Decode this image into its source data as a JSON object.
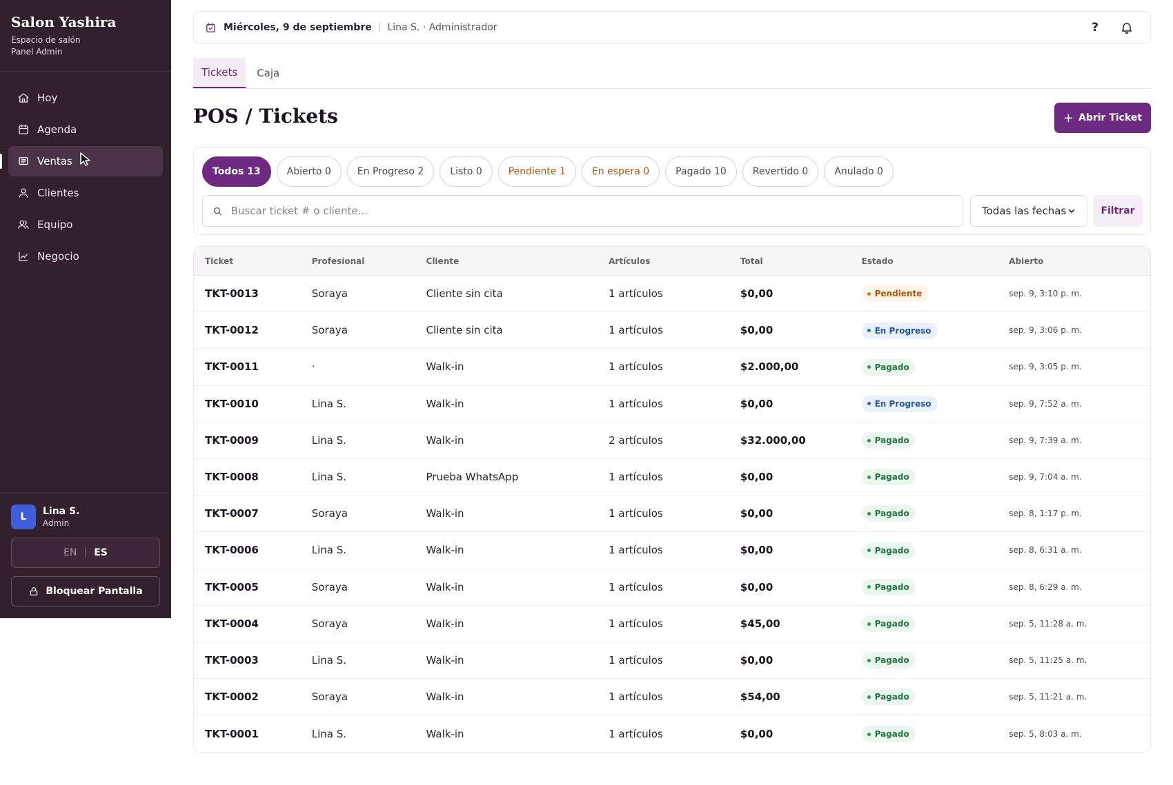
{
  "sidebar": {
    "title": "Salon Yashira",
    "subtitle_1": "Espacio de salón",
    "subtitle_2": "Panel Admin",
    "items": [
      {
        "label": "Hoy",
        "icon": "home-icon"
      },
      {
        "label": "Agenda",
        "icon": "calendar-icon"
      },
      {
        "label": "Ventas",
        "icon": "receipt-icon",
        "active": true
      },
      {
        "label": "Clientes",
        "icon": "user-icon"
      },
      {
        "label": "Equipo",
        "icon": "team-icon"
      },
      {
        "label": "Negocio",
        "icon": "chart-icon"
      }
    ],
    "user": {
      "initial": "L",
      "name": "Lina S.",
      "role": "Admin"
    },
    "lang": {
      "en": "EN",
      "sep": "|",
      "es": "ES",
      "selected": "ES"
    },
    "lock_label": "Bloquear Pantalla"
  },
  "topbar": {
    "date": "Miércoles, 9 de septiembre",
    "sep": "|",
    "user": "Lina S. · Administrador",
    "help": "?"
  },
  "tabs": [
    {
      "label": "Tickets",
      "active": true
    },
    {
      "label": "Caja",
      "active": false
    }
  ],
  "page": {
    "title": "POS / Tickets",
    "open_button": "Abrir Ticket",
    "open_button_icon": "+"
  },
  "filters": {
    "pills": [
      {
        "label": "Todos 13",
        "active": true
      },
      {
        "label": "Abierto 0"
      },
      {
        "label": "En Progreso 2"
      },
      {
        "label": "Listo 0"
      },
      {
        "label": "Pendiente 1",
        "tone": "warn"
      },
      {
        "label": "En espera 0",
        "tone": "warn"
      },
      {
        "label": "Pagado 10"
      },
      {
        "label": "Revertido 0"
      },
      {
        "label": "Anulado 0"
      }
    ],
    "search_placeholder": "Buscar ticket # o cliente...",
    "date_select": "Todas las fechas",
    "filter_button": "Filtrar"
  },
  "table": {
    "headers": [
      "Ticket",
      "Profesional",
      "Cliente",
      "Artículos",
      "Total",
      "Estado",
      "Abierto"
    ],
    "rows": [
      {
        "ticket": "TKT-0013",
        "pro": "Soraya",
        "client": "Cliente sin cita",
        "items": "1 artículos",
        "total": "$0,00",
        "status": "Pendiente",
        "status_key": "pend",
        "opened": "sep. 9, 3:10 p. m."
      },
      {
        "ticket": "TKT-0012",
        "pro": "Soraya",
        "client": "Cliente sin cita",
        "items": "1 artículos",
        "total": "$0,00",
        "status": "En Progreso",
        "status_key": "prog",
        "opened": "sep. 9, 3:06 p. m."
      },
      {
        "ticket": "TKT-0011",
        "pro": "·",
        "client": "Walk-in",
        "items": "1 artículos",
        "total": "$2.000,00",
        "status": "Pagado",
        "status_key": "paid",
        "opened": "sep. 9, 3:05 p. m."
      },
      {
        "ticket": "TKT-0010",
        "pro": "Lina S.",
        "client": "Walk-in",
        "items": "1 artículos",
        "total": "$0,00",
        "status": "En Progreso",
        "status_key": "prog",
        "opened": "sep. 9, 7:52 a. m."
      },
      {
        "ticket": "TKT-0009",
        "pro": "Lina S.",
        "client": "Walk-in",
        "items": "2 artículos",
        "total": "$32.000,00",
        "status": "Pagado",
        "status_key": "paid",
        "opened": "sep. 9, 7:39 a. m."
      },
      {
        "ticket": "TKT-0008",
        "pro": "Lina S.",
        "client": "Prueba WhatsApp",
        "items": "1 artículos",
        "total": "$0,00",
        "status": "Pagado",
        "status_key": "paid",
        "opened": "sep. 9, 7:04 a. m."
      },
      {
        "ticket": "TKT-0007",
        "pro": "Soraya",
        "client": "Walk-in",
        "items": "1 artículos",
        "total": "$0,00",
        "status": "Pagado",
        "status_key": "paid",
        "opened": "sep. 8, 1:17 p. m."
      },
      {
        "ticket": "TKT-0006",
        "pro": "Lina S.",
        "client": "Walk-in",
        "items": "1 artículos",
        "total": "$0,00",
        "status": "Pagado",
        "status_key": "paid",
        "opened": "sep. 8, 6:31 a. m."
      },
      {
        "ticket": "TKT-0005",
        "pro": "Soraya",
        "client": "Walk-in",
        "items": "1 artículos",
        "total": "$0,00",
        "status": "Pagado",
        "status_key": "paid",
        "opened": "sep. 8, 6:29 a. m."
      },
      {
        "ticket": "TKT-0004",
        "pro": "Soraya",
        "client": "Walk-in",
        "items": "1 artículos",
        "total": "$45,00",
        "status": "Pagado",
        "status_key": "paid",
        "opened": "sep. 5, 11:28 a. m."
      },
      {
        "ticket": "TKT-0003",
        "pro": "Lina S.",
        "client": "Walk-in",
        "items": "1 artículos",
        "total": "$0,00",
        "status": "Pagado",
        "status_key": "paid",
        "opened": "sep. 5, 11:25 a. m."
      },
      {
        "ticket": "TKT-0002",
        "pro": "Soraya",
        "client": "Walk-in",
        "items": "1 artículos",
        "total": "$54,00",
        "status": "Pagado",
        "status_key": "paid",
        "opened": "sep. 5, 11:21 a. m."
      },
      {
        "ticket": "TKT-0001",
        "pro": "Lina S.",
        "client": "Walk-in",
        "items": "1 artículos",
        "total": "$0,00",
        "status": "Pagado",
        "status_key": "paid",
        "opened": "sep. 5, 8:03 a. m."
      }
    ]
  },
  "colors": {
    "sidebar_bg": "#33202f",
    "accent": "#6e2a83",
    "pending": "#b4560a",
    "in_progress": "#2356b5",
    "paid": "#23773f"
  }
}
